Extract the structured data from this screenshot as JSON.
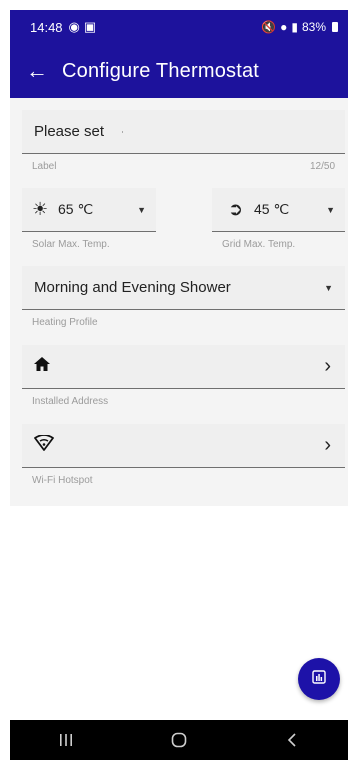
{
  "status_bar": {
    "time": "14:48",
    "battery": "83%"
  },
  "app_bar": {
    "title": "Configure Thermostat"
  },
  "form": {
    "label_field": {
      "value": "Please set",
      "helper": "Label",
      "counter": "12/50"
    },
    "solar_max": {
      "value": "65 ℃",
      "helper": "Solar Max. Temp.",
      "icon": "sun-icon"
    },
    "grid_max": {
      "value": "45 ℃",
      "helper": "Grid Max. Temp.",
      "icon": "lightning-icon"
    },
    "heating_profile": {
      "value": "Morning and Evening Shower",
      "helper": "Heating Profile"
    },
    "installed_address": {
      "helper": "Installed Address",
      "icon": "home-icon"
    },
    "wifi_hotspot": {
      "helper": "Wi-Fi Hotspot",
      "icon": "wifi-icon"
    }
  },
  "fab": {
    "icon": "chart-icon"
  },
  "colors": {
    "primary": "#1d129c",
    "fab": "#1d12a8",
    "field_bg": "#efefef",
    "content_bg": "#f4f4f4"
  }
}
